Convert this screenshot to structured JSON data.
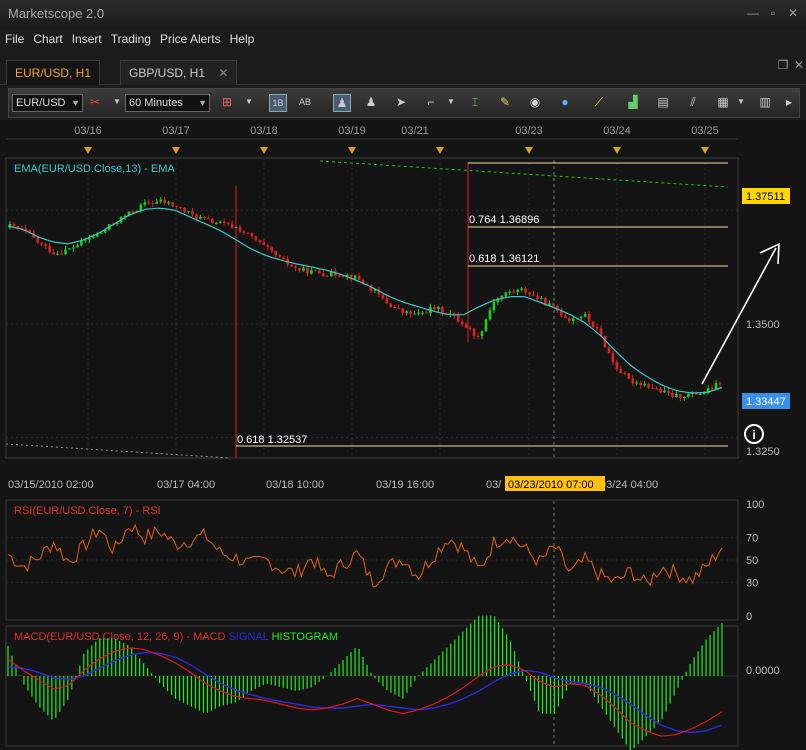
{
  "app": {
    "title": "Marketscope 2.0"
  },
  "window_controls": {
    "minimize": "—",
    "restore": "▫",
    "close": "✕"
  },
  "menu": [
    "File",
    "Chart",
    "Insert",
    "Trading",
    "Price Alerts",
    "Help"
  ],
  "tabs": [
    {
      "label": "EUR/USD, H1",
      "active": true
    },
    {
      "label": "GBP/USD, H1",
      "active": false
    }
  ],
  "toolbar": {
    "symbol": "EUR/USD",
    "timeframe": "60 Minutes",
    "icons": [
      "bar-type-icon",
      "candle-type-icon",
      "chart-style-icon",
      "period-1b-icon",
      "period-ab-icon",
      "pointer-icon",
      "trader-icon",
      "cursor-icon",
      "marker-icon",
      "crosshair-icon",
      "edit-icon",
      "eye-icon",
      "zoom-icon",
      "ruler-icon",
      "indicators-icon",
      "templates-icon",
      "lines-icon",
      "save-icon"
    ]
  },
  "chart_data": [
    {
      "type": "candlestick",
      "title": "EMA(EUR/USD.Close,13) - EMA",
      "symbol": "EUR/USD",
      "timeframe": "H1",
      "top_date_labels": [
        "03/16",
        "03/17",
        "03/18",
        "03/19",
        "03/21",
        "03/23",
        "03/24",
        "03/25"
      ],
      "bottom_time_labels": [
        "03/15/2010 02:00",
        "03/17 04:00",
        "03/18 10:00",
        "03/19 16:00",
        "03/23/2010 07:00",
        "03/24 04:00"
      ],
      "cursor_time": "03/23/2010 07:00",
      "y_ticks": [
        "1.3500",
        "1.3250"
      ],
      "ylim": [
        1.3205,
        1.3865
      ],
      "price_labels": [
        {
          "value": "1.37511",
          "color": "#ffd700"
        },
        {
          "value": "1.33447",
          "color": "#3a8fe8"
        }
      ],
      "close_path": [
        1.3715,
        1.3705,
        1.3675,
        1.3655,
        1.3665,
        1.3685,
        1.37,
        1.3725,
        1.3745,
        1.3765,
        1.377,
        1.3758,
        1.374,
        1.3728,
        1.372,
        1.3712,
        1.369,
        1.3665,
        1.364,
        1.362,
        1.3615,
        1.361,
        1.361,
        1.36,
        1.3575,
        1.3545,
        1.3525,
        1.352,
        1.3535,
        1.3525,
        1.35,
        1.347,
        1.355,
        1.357,
        1.3575,
        1.3555,
        1.3535,
        1.351,
        1.352,
        1.348,
        1.341,
        1.3375,
        1.3368,
        1.3352,
        1.334,
        1.3345,
        1.3349,
        1.337
      ],
      "ema_path": [
        1.3715,
        1.3708,
        1.3691,
        1.368,
        1.3676,
        1.3685,
        1.37,
        1.372,
        1.374,
        1.3752,
        1.3755,
        1.375,
        1.3735,
        1.372,
        1.3705,
        1.3685,
        1.3665,
        1.365,
        1.364,
        1.3632,
        1.3625,
        1.3618,
        1.3608,
        1.3595,
        1.358,
        1.3562,
        1.3548,
        1.3538,
        1.3528,
        1.352,
        1.352,
        1.3538,
        1.3552,
        1.356,
        1.356,
        1.3548,
        1.3535,
        1.3521,
        1.3502,
        1.3475,
        1.344,
        1.3408,
        1.3385,
        1.3366,
        1.3353,
        1.3348,
        1.3349,
        1.336
      ],
      "fibonacci": {
        "left_levels": [
          {
            "label": "0.618",
            "value": "1.32537"
          }
        ],
        "right_levels": [
          {
            "label": "0.764",
            "value": "1.36896"
          },
          {
            "label": "0.618",
            "value": "1.36121"
          }
        ]
      }
    },
    {
      "type": "line",
      "title": "RSI(EUR/USD.Close, 7) - RSI",
      "y_ticks": [
        100,
        70,
        50,
        30,
        0
      ],
      "ylim": [
        0,
        100
      ],
      "values": [
        55,
        44,
        52,
        66,
        48,
        62,
        78,
        58,
        82,
        70,
        76,
        64,
        68,
        72,
        56,
        52,
        46,
        50,
        42,
        38,
        52,
        34,
        46,
        56,
        30,
        44,
        52,
        36,
        54,
        70,
        60,
        40,
        66,
        72,
        60,
        48,
        62,
        38,
        50,
        36,
        30,
        40,
        28,
        44,
        38,
        32,
        44,
        62
      ]
    },
    {
      "type": "line+histogram",
      "title": "MACD(EUR/USD.Close, 12, 26, 9) - MACD",
      "legend": [
        {
          "name": "SIGNAL",
          "color": "#2a2ae0"
        },
        {
          "name": "HISTOGRAM",
          "color": "#22ee22"
        }
      ],
      "y_ticks": [
        "0.0000"
      ],
      "macd": [
        0.0018,
        0.0006,
        -0.0004,
        -0.0014,
        -0.001,
        0.0006,
        0.0018,
        0.0026,
        0.003,
        0.0028,
        0.0022,
        0.0014,
        0.0004,
        -0.0008,
        -0.0016,
        -0.0022,
        -0.0024,
        -0.0026,
        -0.003,
        -0.0034,
        -0.0036,
        -0.0034,
        -0.003,
        -0.0024,
        -0.003,
        -0.0036,
        -0.004,
        -0.0036,
        -0.003,
        -0.0022,
        -0.0012,
        0.0,
        0.001,
        0.0012,
        0.0006,
        -0.0006,
        -0.0012,
        -0.0008,
        -0.001,
        -0.002,
        -0.0034,
        -0.005,
        -0.0058,
        -0.0064,
        -0.0062,
        -0.0056,
        -0.0048,
        -0.0038
      ],
      "signal": [
        0.001,
        0.0008,
        0.0004,
        -0.0002,
        -0.0004,
        0.0,
        0.0008,
        0.0016,
        0.0022,
        0.0025,
        0.0024,
        0.002,
        0.0012,
        0.0002,
        -0.0008,
        -0.0015,
        -0.002,
        -0.0024,
        -0.0027,
        -0.003,
        -0.0033,
        -0.0034,
        -0.0034,
        -0.0032,
        -0.003,
        -0.0032,
        -0.0034,
        -0.0036,
        -0.0034,
        -0.003,
        -0.0024,
        -0.0016,
        -0.0006,
        0.0002,
        0.0006,
        0.0004,
        -0.0002,
        -0.0006,
        -0.0008,
        -0.0012,
        -0.002,
        -0.003,
        -0.0042,
        -0.0052,
        -0.0058,
        -0.006,
        -0.0058,
        -0.0052
      ],
      "ylim": [
        -0.007,
        0.0036
      ]
    }
  ]
}
